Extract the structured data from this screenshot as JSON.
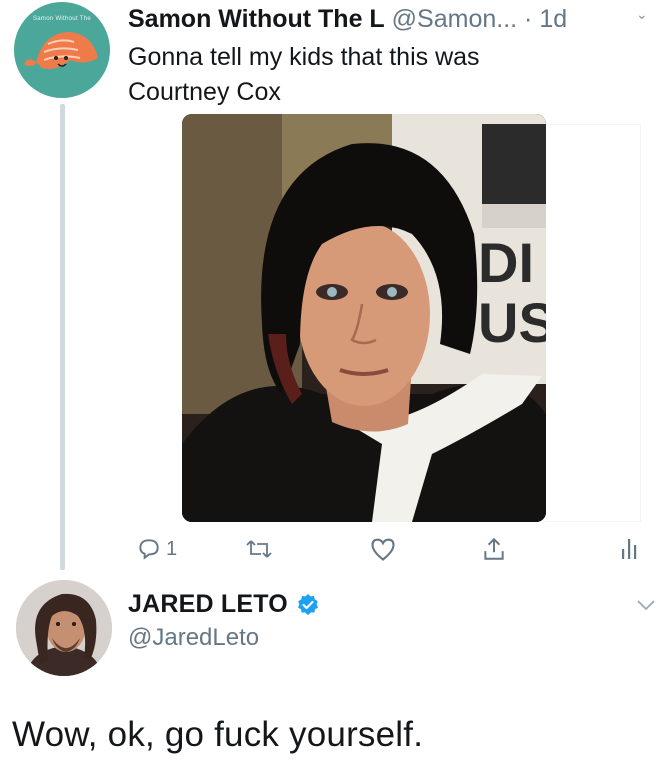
{
  "tweet": {
    "author": {
      "display_name": "Samon Without The L",
      "handle": "@Samon...",
      "avatar_caption": "Samon Without The"
    },
    "separator": "·",
    "time": "1d",
    "text": "Gonna tell my kids that this was Courtney Cox",
    "media_sign_text": [
      "DI",
      "US"
    ],
    "actions": {
      "reply_count": "1"
    }
  },
  "reply": {
    "author": {
      "display_name": "JARED LETO",
      "handle": "@JaredLeto",
      "verified": true
    },
    "text": "Wow, ok, go fuck yourself."
  },
  "colors": {
    "accent": "#1da1f2",
    "secondary_text": "#657786",
    "avatar_bg": "#4aa79a"
  }
}
